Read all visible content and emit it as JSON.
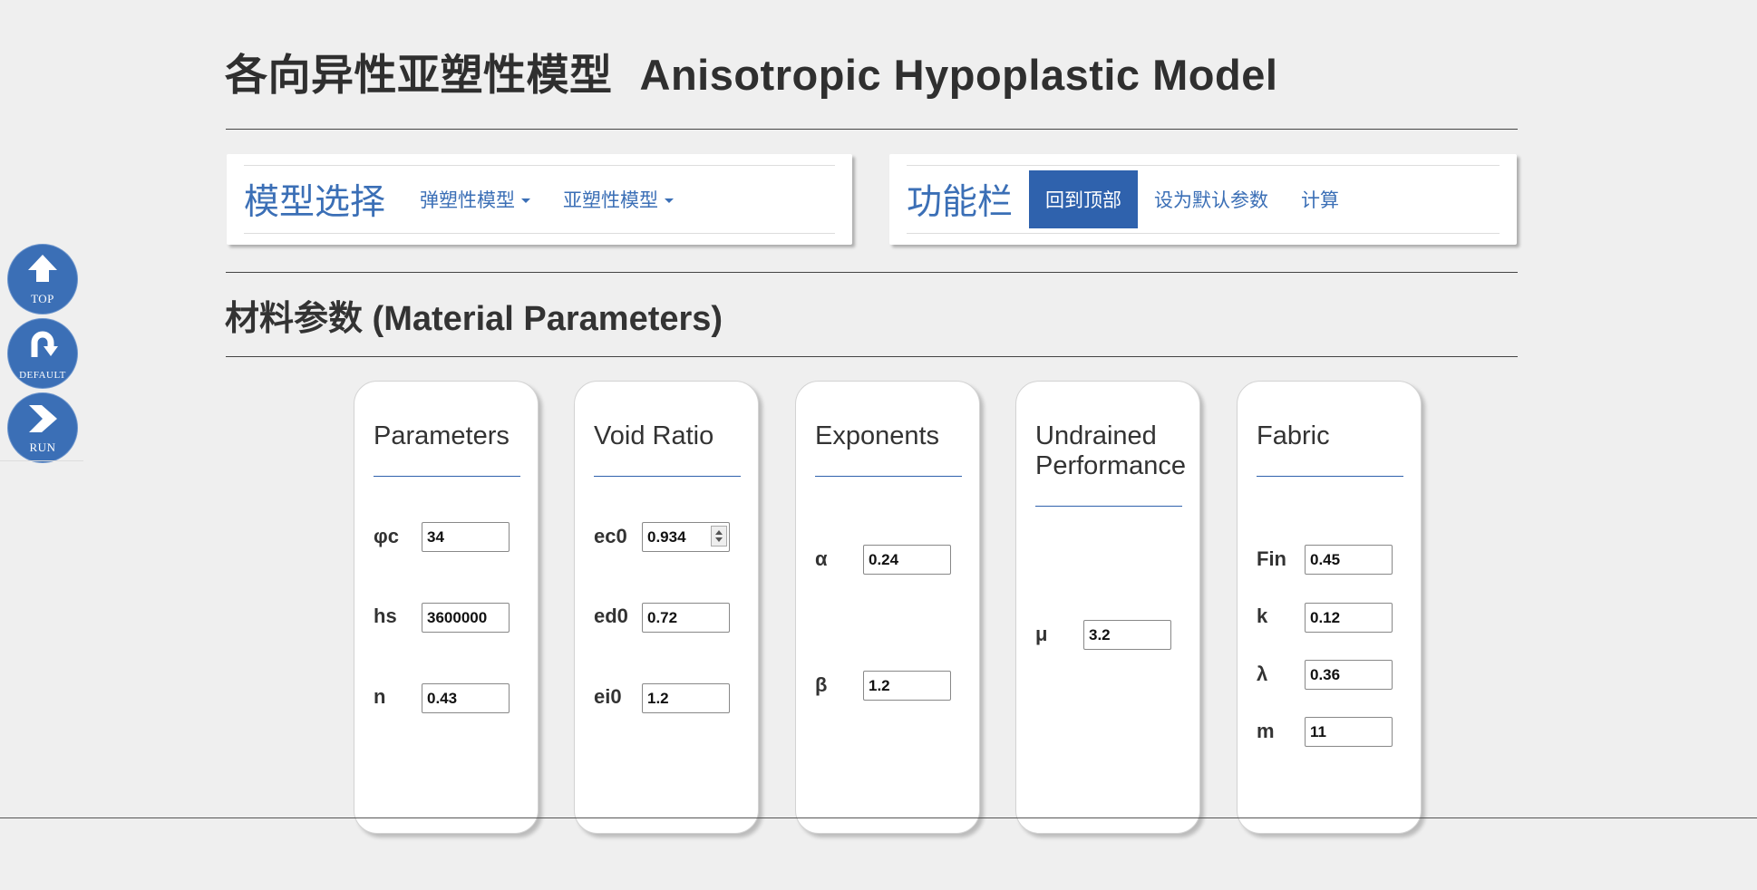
{
  "page": {
    "title_cn": "各向异性亚塑性模型",
    "title_en": "Anisotropic Hypoplastic Model"
  },
  "model_panel": {
    "brand": "模型选择",
    "items": [
      {
        "label": "弹塑性模型"
      },
      {
        "label": "亚塑性模型"
      }
    ]
  },
  "function_panel": {
    "brand": "功能栏",
    "items": [
      {
        "label": "回到顶部",
        "active": true
      },
      {
        "label": "设为默认参数"
      },
      {
        "label": "计算"
      }
    ]
  },
  "section": {
    "title": "材料参数 (Material Parameters)"
  },
  "side_buttons": [
    {
      "label": "TOP",
      "icon": "arrow-up-icon"
    },
    {
      "label": "DEFAULT",
      "icon": "return-arrow-icon"
    },
    {
      "label": "RUN",
      "icon": "chevron-right-icon"
    }
  ],
  "cards": [
    {
      "title": "Parameters",
      "params": [
        {
          "label": "φc",
          "value": "34"
        },
        {
          "label": "hs",
          "value": "3600000"
        },
        {
          "label": "n",
          "value": "0.43"
        }
      ]
    },
    {
      "title": "Void Ratio",
      "params": [
        {
          "label": "ec0",
          "value": "0.934"
        },
        {
          "label": "ed0",
          "value": "0.72"
        },
        {
          "label": "ei0",
          "value": "1.2"
        }
      ]
    },
    {
      "title": "Exponents",
      "params": [
        {
          "label": "α",
          "value": "0.24"
        },
        {
          "label": "β",
          "value": "1.2"
        }
      ]
    },
    {
      "title": "Undrained Performance",
      "params": [
        {
          "label": "μ",
          "value": "3.2"
        }
      ]
    },
    {
      "title": "Fabric",
      "params": [
        {
          "label": "Fin",
          "value": "0.45"
        },
        {
          "label": "k",
          "value": "0.12"
        },
        {
          "label": "λ",
          "value": "0.36"
        },
        {
          "label": "m",
          "value": "11"
        }
      ]
    }
  ],
  "colors": {
    "accent": "#2f62ad",
    "link": "#3b6fb6",
    "background": "#efefef"
  }
}
